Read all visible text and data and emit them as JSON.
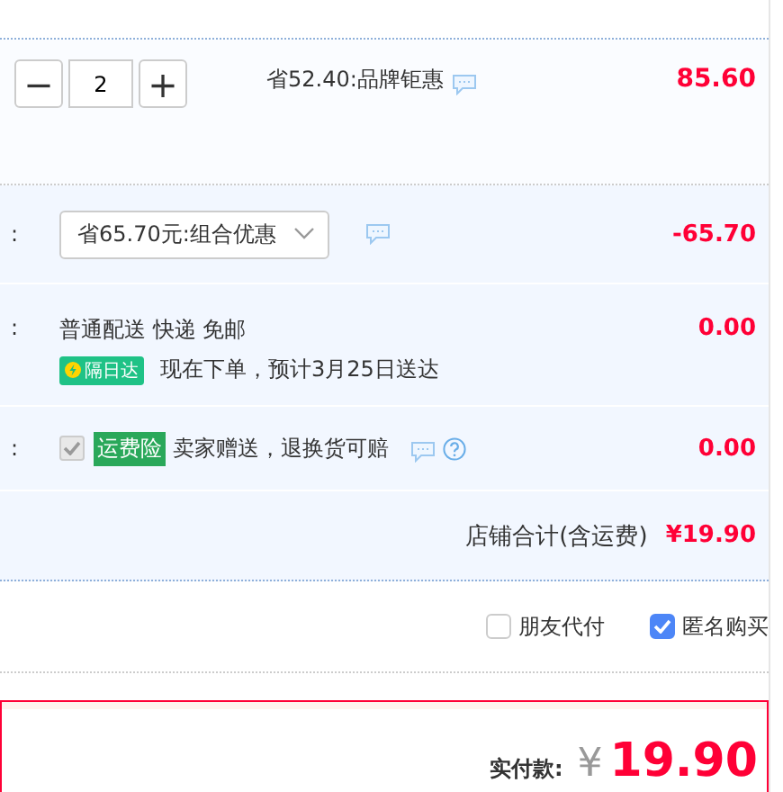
{
  "product": {
    "minus": "−",
    "quantity": "2",
    "plus": "+",
    "promo": "省52.40:品牌钜惠",
    "price": "85.60"
  },
  "rows": [
    {
      "kind": "dropdown",
      "label": ":",
      "value": "省65.70元:组合优惠",
      "amount": "-65.70"
    },
    {
      "kind": "delivery",
      "label": ":",
      "text": "普通配送 快递 免邮",
      "badge": "隔日达",
      "note": "现在下单，预计3月25日送达",
      "amount": "0.00"
    },
    {
      "kind": "insurance",
      "label": ":",
      "checked": true,
      "disabled": true,
      "badge": "运费险",
      "text": "卖家赠送，退换货可赔",
      "amount": "0.00"
    }
  ],
  "subtotal": {
    "label": "店铺合计(含运费)",
    "amount": "¥19.90"
  },
  "options": [
    {
      "label": "朋友代付",
      "checked": false
    },
    {
      "label": "匿名购买",
      "checked": true
    }
  ],
  "total": {
    "label": "实付款:",
    "currency": "¥",
    "amount": "19.90"
  }
}
